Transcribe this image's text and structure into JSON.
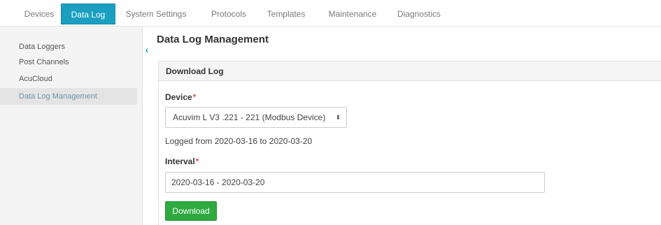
{
  "topnav": {
    "tabs": [
      {
        "label": "Devices"
      },
      {
        "label": "Data Log"
      },
      {
        "label": "System Settings"
      },
      {
        "label": "Protocols"
      },
      {
        "label": "Templates"
      },
      {
        "label": "Maintenance"
      },
      {
        "label": "Diagnostics"
      }
    ],
    "active_tab": "Data Log",
    "accent_color": "#1a9fc0"
  },
  "sidebar": {
    "items": [
      {
        "label": "Data Loggers"
      },
      {
        "label": "Post Channels"
      },
      {
        "label": "AcuCloud"
      },
      {
        "label": "Data Log Management"
      }
    ],
    "active_item": "Data Log Management",
    "collapse_icon": "chevron-left-icon"
  },
  "main": {
    "title": "Data Log Management",
    "panel": {
      "heading": "Download Log",
      "device_label": "Device",
      "required_mark": "*",
      "device_selected": "Acuvim L V3 .221 - 221 (Modbus Device)",
      "logged_range": "Logged from 2020-03-16 to 2020-03-20",
      "interval_label": "Interval",
      "interval_value": "2020-03-16 - 2020-03-20",
      "download_label": "Download",
      "download_color": "#2eaa3f"
    }
  }
}
